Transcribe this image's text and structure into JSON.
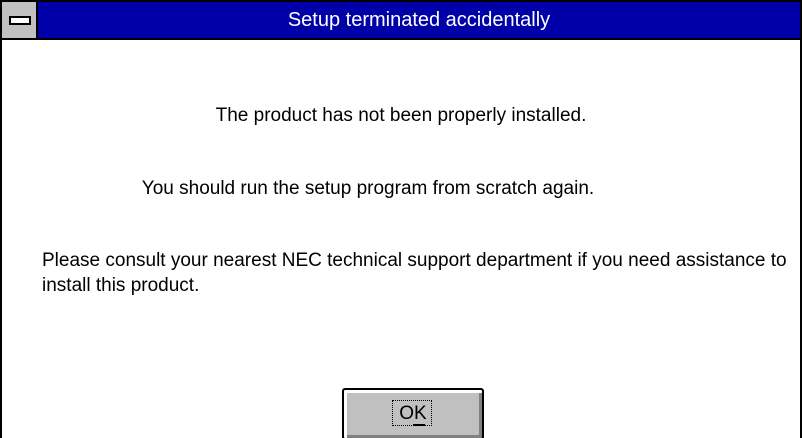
{
  "window": {
    "title": "Setup terminated accidentally",
    "system_menu_icon": "minus-icon"
  },
  "messages": {
    "line1": "The product has not been properly installed.",
    "line2": "You should run the setup program from scratch again.",
    "line3": "Please consult your nearest NEC technical support department if you need assistance to install this product."
  },
  "buttons": {
    "ok_label": "OK",
    "ok_mnemonic": "K"
  },
  "colors": {
    "titlebar": "#0000a8",
    "title_text": "#ffffff",
    "background": "#ffffff",
    "button_face": "#c0c0c0"
  }
}
